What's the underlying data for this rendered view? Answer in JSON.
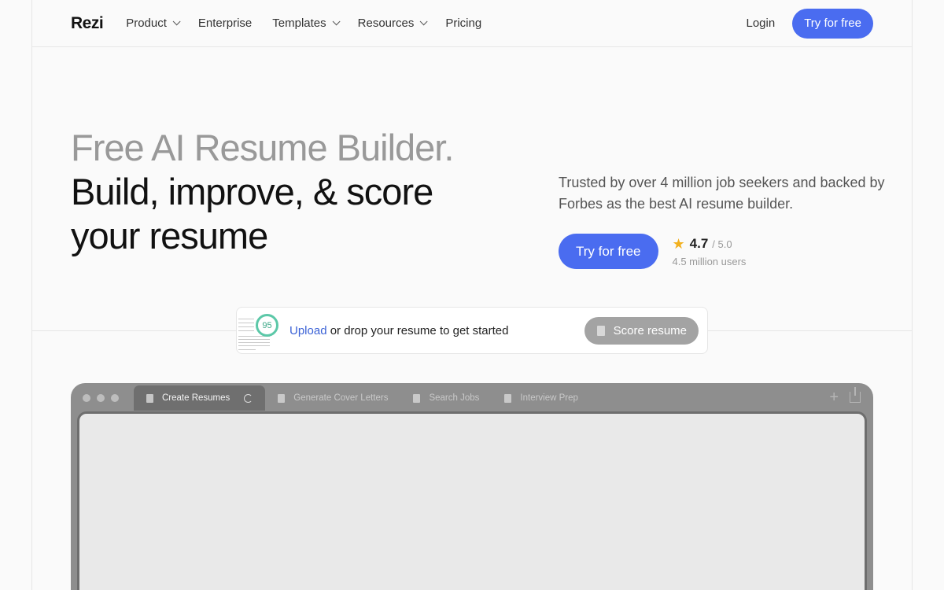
{
  "nav": {
    "logo": "Rezi",
    "items": [
      {
        "label": "Product",
        "dropdown": true
      },
      {
        "label": "Enterprise",
        "dropdown": false
      },
      {
        "label": "Templates",
        "dropdown": true
      },
      {
        "label": "Resources",
        "dropdown": true
      },
      {
        "label": "Pricing",
        "dropdown": false
      }
    ],
    "login": "Login",
    "cta": "Try for free"
  },
  "hero": {
    "line1": "Free AI Resume Builder.",
    "line2": "Build, improve, & score",
    "line3": "your resume",
    "description": "Trusted by over 4 million job seekers and backed by Forbes as the best AI resume builder.",
    "cta": "Try for free",
    "rating": {
      "score": "4.7",
      "max": "/ 5.0",
      "users": "4.5 million users"
    }
  },
  "upload": {
    "score_badge": "95",
    "link": "Upload",
    "text": " or drop your resume to get started",
    "button": "Score resume"
  },
  "window": {
    "tabs": [
      {
        "label": "Create Resumes",
        "active": true
      },
      {
        "label": "Generate Cover Letters",
        "active": false
      },
      {
        "label": "Search Jobs",
        "active": false
      },
      {
        "label": "Interview Prep",
        "active": false
      }
    ]
  },
  "colors": {
    "accent": "#4a6cf0",
    "star": "#f2b01e",
    "score_ring": "#5cc8a8"
  }
}
